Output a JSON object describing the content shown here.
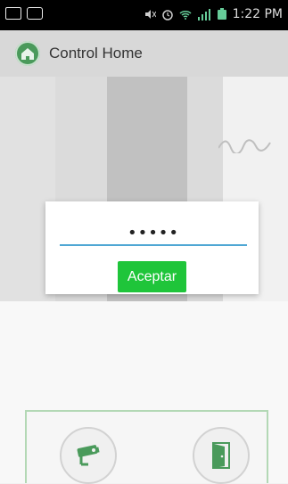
{
  "status_bar": {
    "time": "1:22 PM",
    "icons": [
      "photo-icon",
      "camera-icon",
      "mute-icon",
      "alarm-icon",
      "wifi-icon",
      "signal-icon",
      "battery-icon"
    ]
  },
  "app": {
    "title": "Control Home",
    "logo_icon": "house-icon",
    "accent": "#4a9a5b"
  },
  "dialog": {
    "password_value": "•••••",
    "accept_label": "Aceptar",
    "accent": "#1fc53a",
    "underline": "#4fa7d4"
  },
  "controls": {
    "items": [
      {
        "icon": "security-camera-icon"
      },
      {
        "icon": "door-icon"
      }
    ]
  }
}
